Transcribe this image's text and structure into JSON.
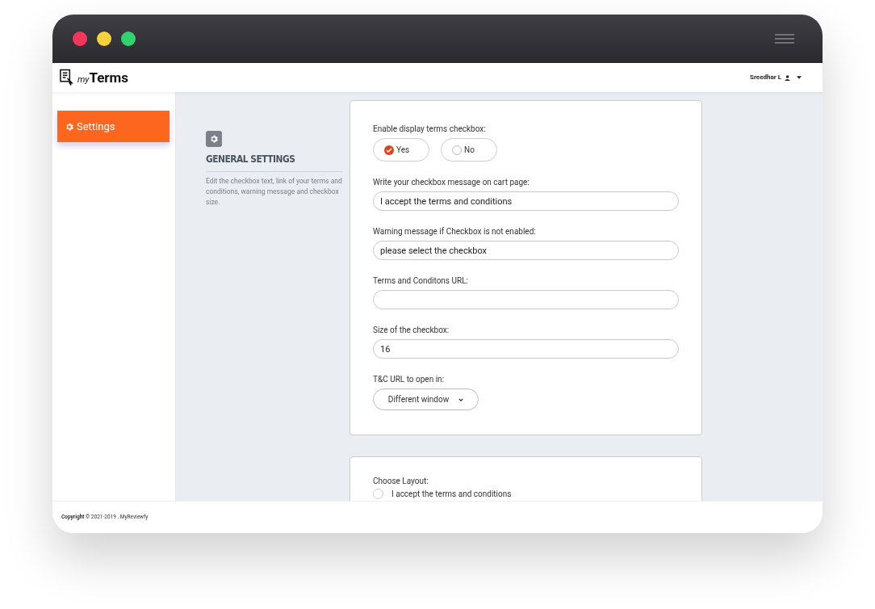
{
  "app": {
    "logo_prefix": "my",
    "logo_name": "Terms",
    "user": "Sreedhar L"
  },
  "sidebar": {
    "items": [
      {
        "label": "Settings",
        "selected": true
      }
    ]
  },
  "general": {
    "title": "GENERAL SETTINGS",
    "description": "Edit the checkbox text, link of your terms and conditions, warning message and checkbox size.",
    "enable_label": "Enable display terms checkbox:",
    "options": [
      {
        "label": "Yes",
        "selected": true
      },
      {
        "label": "No",
        "selected": false
      }
    ],
    "fields": [
      {
        "label": "Write your checkbox message on cart page:",
        "value": "I accept the terms and conditions"
      },
      {
        "label": "Warning message if Checkbox is not enabled:",
        "value": "please select the checkbox"
      },
      {
        "label": "Terms and Conditons URL:"
      },
      {
        "label": "Size of the checkbox:",
        "value": "16"
      }
    ],
    "open_label": "T&C URL to open in:",
    "open_value": "Different window"
  },
  "layout": {
    "label": "Choose Layout:",
    "options": [
      {
        "label": "I accept the terms and conditions",
        "selected": false
      }
    ]
  },
  "footer": {
    "copyright": "Copyright",
    "text": "© 2021-2019 . MyReviewfy"
  }
}
